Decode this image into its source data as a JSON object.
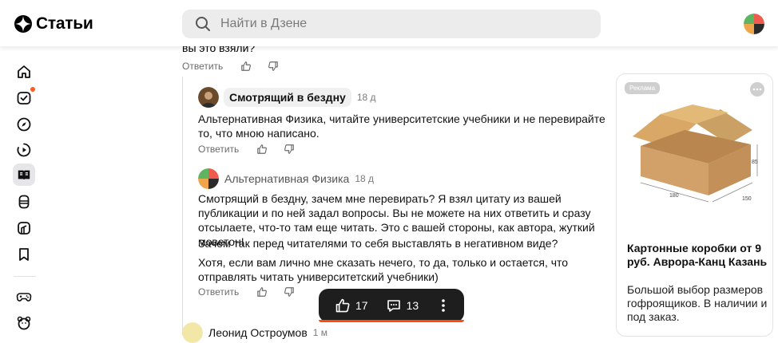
{
  "header": {
    "logo_text": "Статьи",
    "search_placeholder": "Найти в Дзене"
  },
  "sidebar": {
    "items": [
      {
        "icon": "home-icon"
      },
      {
        "icon": "subscriptions-icon",
        "badge": true
      },
      {
        "icon": "compass-icon"
      },
      {
        "icon": "video-icon"
      },
      {
        "icon": "articles-icon",
        "active": true
      },
      {
        "icon": "shorts-icon"
      },
      {
        "icon": "cube-icon"
      },
      {
        "icon": "bookmark-icon"
      },
      {
        "icon": "games-icon"
      },
      {
        "icon": "kids-icon"
      }
    ]
  },
  "feed": {
    "cut_text": "вы это взяли?",
    "reply_label": "Ответить",
    "comments": [
      {
        "author": "Смотрящий в бездну",
        "time": "18 д",
        "paragraphs": [
          "Альтернативная Физика, читайте университетские учебники и не перевирайте то, что мною написано."
        ]
      },
      {
        "author": "Альтернативная Физика",
        "time": "18 д",
        "paragraphs": [
          "Смотрящий в бездну, зачем мне перевирать? Я взял цитату из вашей публикации и по ней задал вопросы. Вы не можете на них ответить и сразу отсылаете, что-то там еще читать. Это с вашей стороны, как автора, жуткий моветон!",
          "Зачем так перед читателями то себя выставлять в негативном виде?",
          "Хотя, если вам лично мне сказать нечего, то да, только и остается, что отправлять читать университетский учебники)"
        ]
      },
      {
        "author": "Леонид Остроумов",
        "time": "1 м"
      }
    ]
  },
  "bottom_bar": {
    "likes": "17",
    "comments": "13"
  },
  "ad": {
    "badge": "Реклама",
    "title": "Картонные коробки от 9 руб. Аврора-Канц Казань",
    "description": "Большой выбор размеров гофроящиков. В наличии и под заказ.",
    "dims": {
      "h": "85",
      "l": "180",
      "w": "150"
    }
  },
  "colors": {
    "accent": "#ff4a12",
    "bar_bg": "#1e1e1e",
    "muted": "#6b6b6b"
  }
}
